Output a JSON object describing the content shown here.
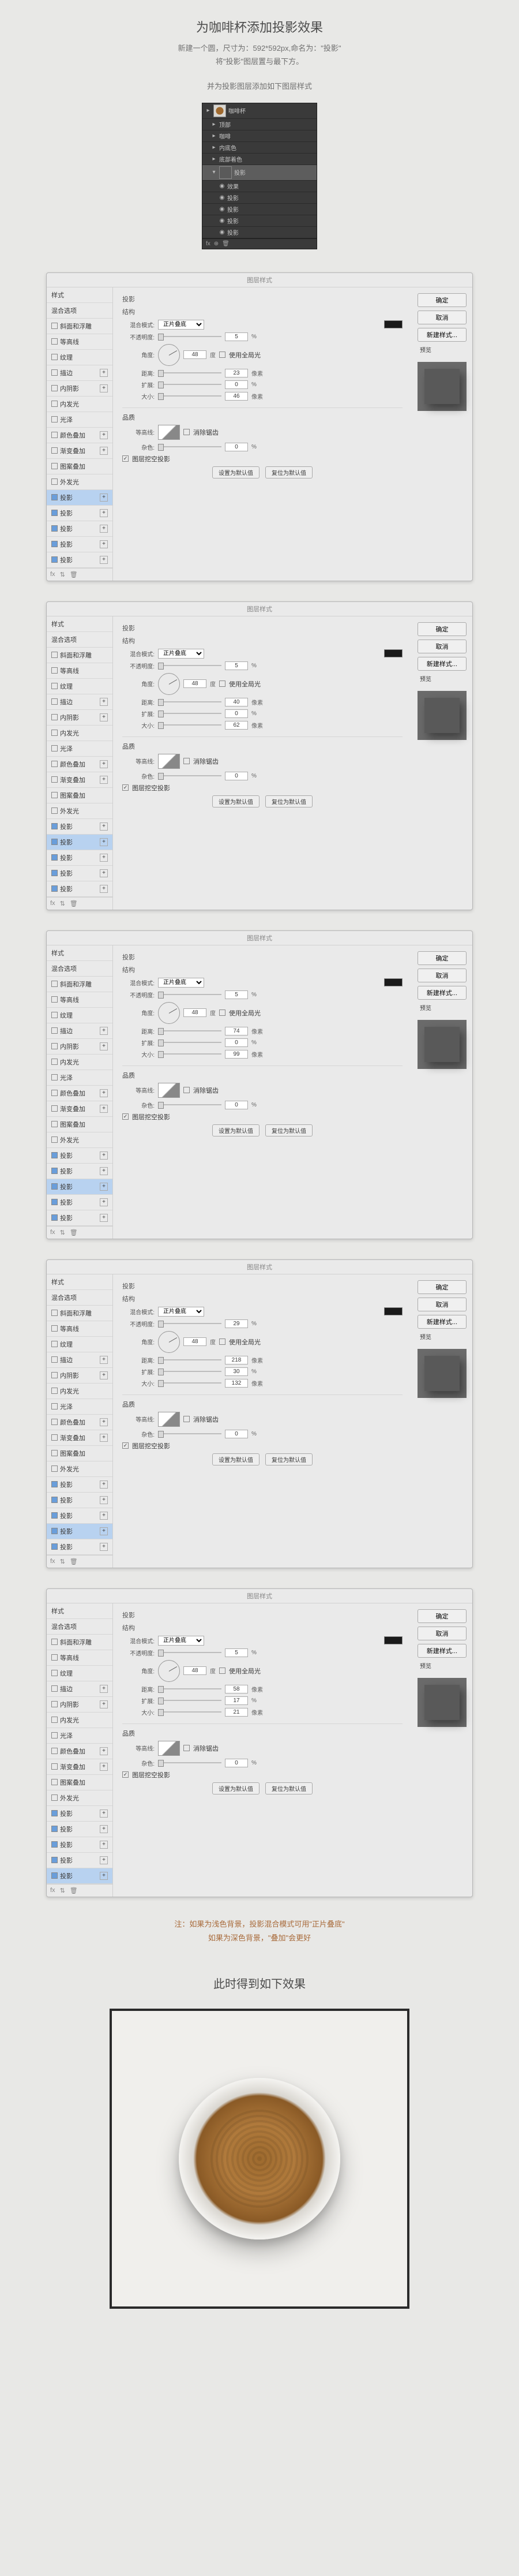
{
  "header": {
    "title": "为咖啡杯添加投影效果",
    "line1": "新建一个圆，尺寸为：592*592px,命名为：\"投影\"",
    "line2": "将\"投影\"图层置与最下方。",
    "line3": "并为投影图层添加如下图层样式"
  },
  "layers_panel": {
    "rows": [
      {
        "icon": "▸",
        "name": "咖啡杯",
        "thumb": "coffee"
      },
      {
        "icon": "▸",
        "name": "顶部",
        "indent": 1
      },
      {
        "icon": "▸",
        "name": "咖啡",
        "indent": 1
      },
      {
        "icon": "▸",
        "name": "内底色",
        "indent": 1
      },
      {
        "icon": "▸",
        "name": "底部着色",
        "indent": 1
      },
      {
        "icon": "▾",
        "name": "投影",
        "thumb": "plain",
        "sel": true,
        "indent": 1
      },
      {
        "icon": "◉",
        "name": "效果",
        "indent": 2
      },
      {
        "icon": "◉",
        "name": "投影",
        "indent": 2
      },
      {
        "icon": "◉",
        "name": "投影",
        "indent": 2
      },
      {
        "icon": "◉",
        "name": "投影",
        "indent": 2
      },
      {
        "icon": "◉",
        "name": "投影",
        "indent": 2
      }
    ]
  },
  "side_labels": {
    "styles": "样式",
    "blend": "混合选项",
    "bevel": "斜面和浮雕",
    "contour_s": "等高线",
    "texture": "纹理",
    "stroke": "描边",
    "inner_shadow": "内阴影",
    "inner_glow": "内发光",
    "satin": "光泽",
    "color_overlay": "颜色叠加",
    "grad_overlay": "渐变叠加",
    "pat_overlay": "图案叠加",
    "outer_glow": "外发光",
    "drop": "投影"
  },
  "main_labels": {
    "section": "投影",
    "structure": "结构",
    "blend_mode": "混合模式:",
    "mode_val": "正片叠底",
    "opacity": "不透明度:",
    "angle": "角度:",
    "use_global": "使用全局光",
    "distance": "距离:",
    "spread": "扩展:",
    "size": "大小:",
    "quality": "品质",
    "contour": "等高线:",
    "anti": "消除锯齿",
    "noise": "杂色:",
    "knockout": "图层挖空投影",
    "make_default": "设置为默认值",
    "reset_default": "复位为默认值",
    "px": "像素",
    "pct": "%",
    "deg": "度"
  },
  "rbar": {
    "ok": "确定",
    "cancel": "取消",
    "new_style": "新建样式...",
    "preview": "预览"
  },
  "dialogs": [
    {
      "sel_idx": 0,
      "opacity": "5",
      "angle": "48",
      "distance": "23",
      "spread": "0",
      "size": "46"
    },
    {
      "sel_idx": 1,
      "opacity": "5",
      "angle": "48",
      "distance": "40",
      "spread": "0",
      "size": "62"
    },
    {
      "sel_idx": 2,
      "opacity": "5",
      "angle": "48",
      "distance": "74",
      "spread": "0",
      "size": "99"
    },
    {
      "sel_idx": 3,
      "opacity": "29",
      "angle": "48",
      "distance": "218",
      "spread": "30",
      "size": "132"
    },
    {
      "sel_idx": 4,
      "opacity": "5",
      "angle": "48",
      "distance": "58",
      "spread": "17",
      "size": "21"
    }
  ],
  "note": {
    "l1": "注：如果为浅色背景，投影混合模式可用\"正片叠底\"",
    "l2": "如果为深色背景，\"叠加\"会更好"
  },
  "result_title": "此时得到如下效果"
}
